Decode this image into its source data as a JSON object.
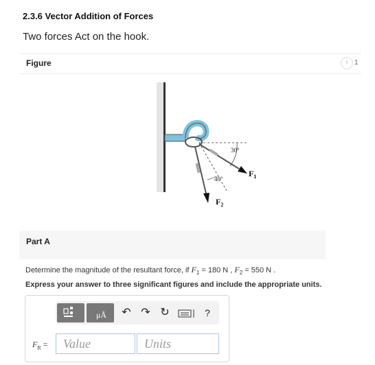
{
  "header": {
    "section_title": "2.3.6 Vector Addition of Forces",
    "intro": "Two forces Act on the hook."
  },
  "figure": {
    "label": "Figure",
    "pager": "1",
    "labels": {
      "angle_30": "30°",
      "angle_40": "40°",
      "f1": "F",
      "f1_sub": "1",
      "f2": "F",
      "f2_sub": "2"
    }
  },
  "part_a": {
    "label": "Part A"
  },
  "question": {
    "prefix": "Determine the magnitude of the resultant force, if ",
    "f1_symbol": "F",
    "f1_sub": "1",
    "f1_value": " = 180 N , ",
    "f2_symbol": "F",
    "f2_sub": "2",
    "f2_value": " = 550 N .",
    "instruction": "Express your answer to three significant figures and include the appropriate units."
  },
  "answer": {
    "label_main": "F",
    "label_sub": "R",
    "label_eq": " =",
    "value_placeholder": "Value",
    "units_placeholder": "Units"
  },
  "toolbar": {
    "help_label": "?",
    "icons": [
      "templates-icon",
      "units-icon",
      "undo-icon",
      "redo-icon",
      "reset-icon",
      "keyboard-icon",
      "help-icon"
    ]
  },
  "colors": {
    "input_border": "#a9c6e3",
    "toolbar_bg": "#f2f2f2",
    "dark_btn": "#787878",
    "hook": "#7ec3dc"
  }
}
